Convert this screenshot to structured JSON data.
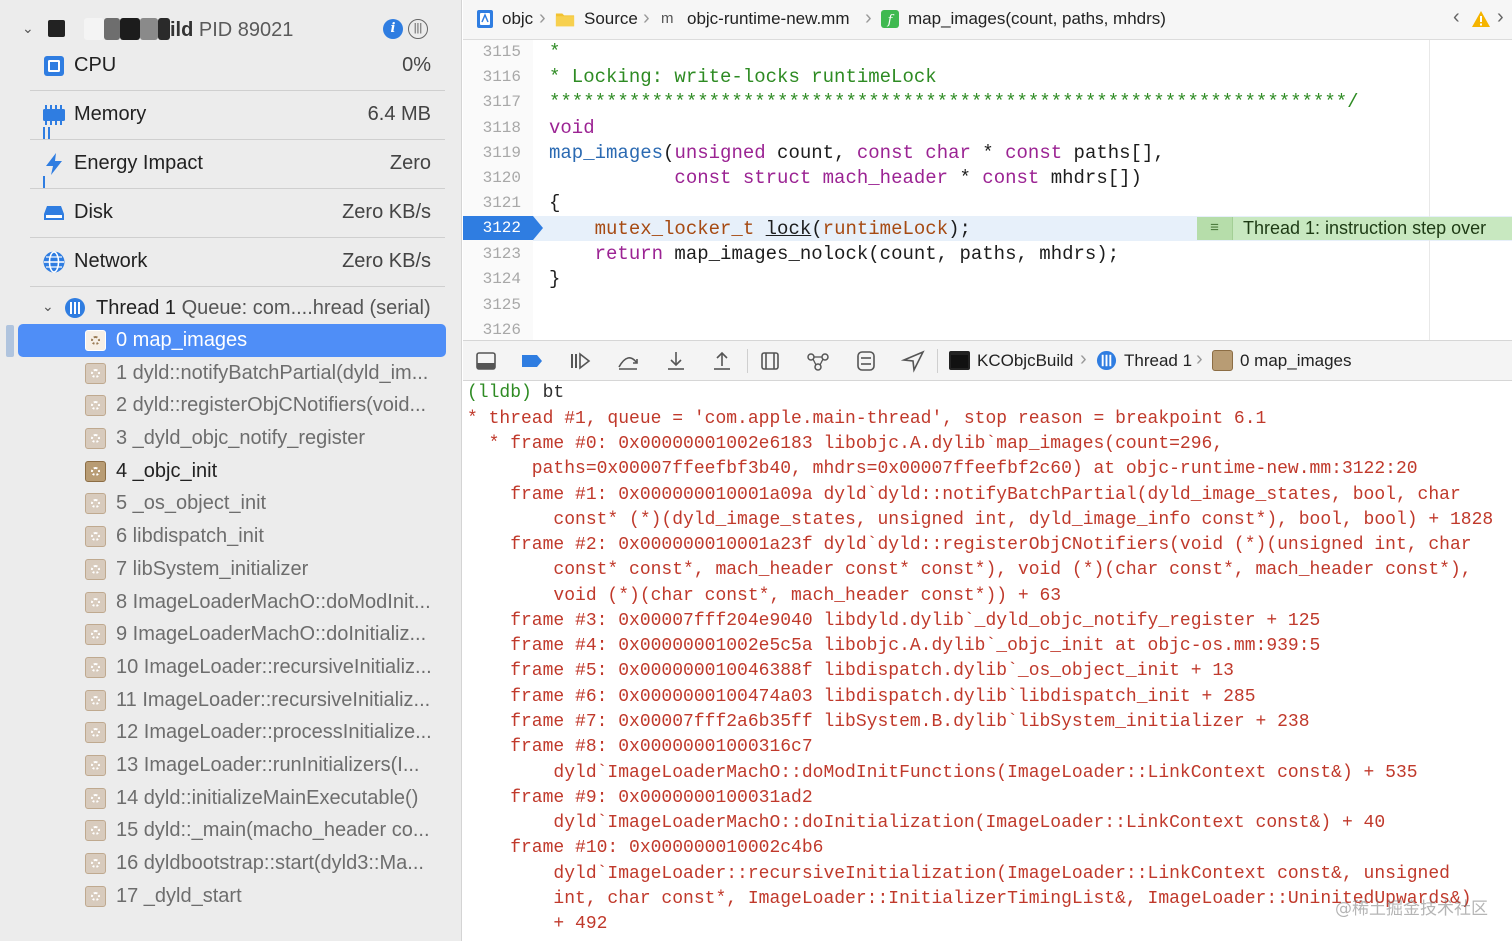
{
  "navigator": {
    "process": {
      "name_suffix": "ild",
      "pid_label": "PID 89021"
    },
    "gauges": [
      {
        "label": "CPU",
        "value": "0%"
      },
      {
        "label": "Memory",
        "value": "6.4 MB"
      },
      {
        "label": "Energy Impact",
        "value": "Zero"
      },
      {
        "label": "Disk",
        "value": "Zero KB/s"
      },
      {
        "label": "Network",
        "value": "Zero KB/s"
      }
    ],
    "thread": {
      "name": "Thread 1",
      "queue": "Queue: com....hread (serial)"
    },
    "frames": [
      "0 map_images",
      "1 dyld::notifyBatchPartial(dyld_im...",
      "2 dyld::registerObjCNotifiers(void...",
      "3 _dyld_objc_notify_register",
      "4 _objc_init",
      "5 _os_object_init",
      "6 libdispatch_init",
      "7 libSystem_initializer",
      "8 ImageLoaderMachO::doModInit...",
      "9 ImageLoaderMachO::doInitializ...",
      "10 ImageLoader::recursiveInitializ...",
      "11 ImageLoader::recursiveInitializ...",
      "12 ImageLoader::processInitialize...",
      "13 ImageLoader::runInitializers(I...",
      "14 dyld::initializeMainExecutable()",
      "15 dyld::_main(macho_header co...",
      "16 dyldbootstrap::start(dyld3::Ma...",
      "17 _dyld_start"
    ]
  },
  "jumpbar": {
    "crumbs": [
      "objc",
      "Source",
      "objc-runtime-new.mm",
      "map_images(count, paths, mhdrs)"
    ]
  },
  "editor": {
    "line_numbers": [
      "3115",
      "3116",
      "3117",
      "3118",
      "3119",
      "3120",
      "3121",
      "3122",
      "3123",
      "3124",
      "3125",
      "3126"
    ],
    "current_line": "3122",
    "lines": {
      "l3115": "*",
      "l3116": "* Locking: write-locks runtimeLock",
      "l3117": "**********************************************************************/",
      "l3118": "void",
      "l3119_fn": "map_images",
      "l3119_a": "(",
      "l3119_kw1": "unsigned",
      "l3119_b": " count, ",
      "l3119_kw2": "const char",
      "l3119_c": " * ",
      "l3119_kw3": "const",
      "l3119_d": " paths[],",
      "l3120_pad": "           ",
      "l3120_kw1": "const struct",
      "l3120_typ": " mach_header",
      "l3120_b": " * ",
      "l3120_kw2": "const",
      "l3120_c": " mhdrs[])",
      "l3121": "{",
      "l3122_pad": "    ",
      "l3122_typ": "mutex_locker_t",
      "l3122_sp": " ",
      "l3122_lock": "lock",
      "l3122_a": "(",
      "l3122_arg": "runtimeLock",
      "l3122_b": ");",
      "l3123_pad": "    ",
      "l3123_kw": "return",
      "l3123_rest": " map_images_nolock(count, paths, mhdrs);",
      "l3124": "}"
    },
    "annotation": "Thread 1: instruction step over"
  },
  "debugbar": {
    "crumbs": [
      "KCObjcBuild",
      "Thread 1",
      "0 map_images"
    ]
  },
  "console": {
    "prompt": "(lldb)",
    "command": " bt",
    "lines": [
      "* thread #1, queue = 'com.apple.main-thread', stop reason = breakpoint 6.1",
      "  * frame #0: 0x00000001002e6183 libobjc.A.dylib`map_images(count=296,",
      "      paths=0x00007ffeefbf3b40, mhdrs=0x00007ffeefbf2c60) at objc-runtime-new.mm:3122:20",
      "    frame #1: 0x000000010001a09a dyld`dyld::notifyBatchPartial(dyld_image_states, bool, char",
      "        const* (*)(dyld_image_states, unsigned int, dyld_image_info const*), bool, bool) + 1828",
      "    frame #2: 0x000000010001a23f dyld`dyld::registerObjCNotifiers(void (*)(unsigned int, char",
      "        const* const*, mach_header const* const*), void (*)(char const*, mach_header const*),",
      "        void (*)(char const*, mach_header const*)) + 63",
      "    frame #3: 0x00007fff204e9040 libdyld.dylib`_dyld_objc_notify_register + 125",
      "    frame #4: 0x00000001002e5c5a libobjc.A.dylib`_objc_init at objc-os.mm:939:5",
      "    frame #5: 0x000000010046388f libdispatch.dylib`_os_object_init + 13",
      "    frame #6: 0x0000000100474a03 libdispatch.dylib`libdispatch_init + 285",
      "    frame #7: 0x00007fff2a6b35ff libSystem.B.dylib`libSystem_initializer + 238",
      "    frame #8: 0x00000001000316c7",
      "        dyld`ImageLoaderMachO::doModInitFunctions(ImageLoader::LinkContext const&) + 535",
      "    frame #9: 0x0000000100031ad2",
      "        dyld`ImageLoaderMachO::doInitialization(ImageLoader::LinkContext const&) + 40",
      "    frame #10: 0x000000010002c4b6",
      "        dyld`ImageLoader::recursiveInitialization(ImageLoader::LinkContext const&, unsigned",
      "        int, char const*, ImageLoader::InitializerTimingList&, ImageLoader::UninitedUpwards&)",
      "        + 492"
    ],
    "watermark": "@稀土掘金技术社区"
  },
  "colors": {
    "selection": "#4f8ef7",
    "pc_marker": "#2f7de1",
    "thread_annotation": "#c8e8c0",
    "console_text": "#c0392b",
    "comment": "#2e8b23",
    "keyword": "#9b2393"
  }
}
